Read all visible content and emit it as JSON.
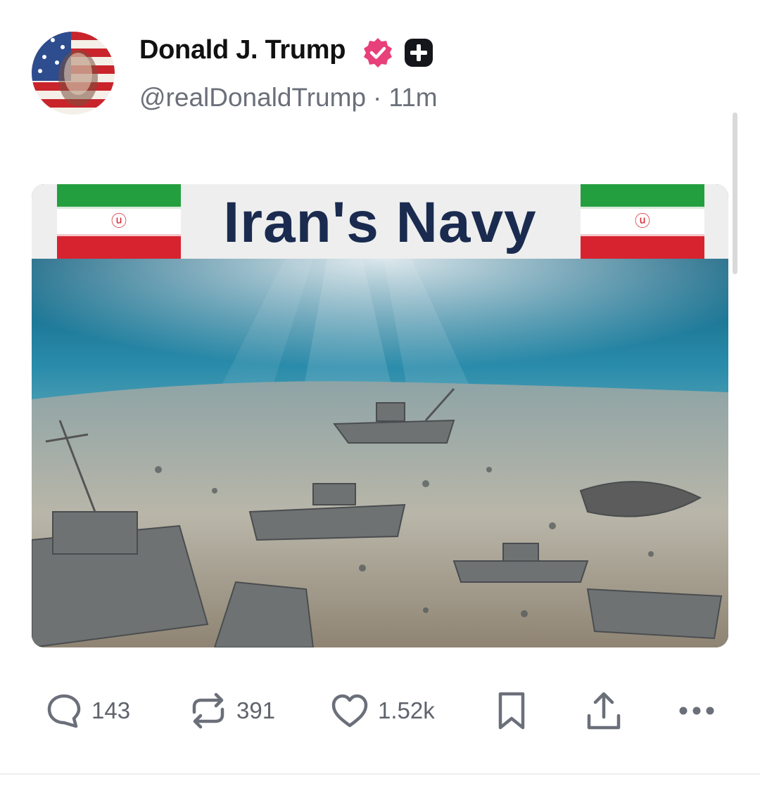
{
  "author": {
    "name": "Donald J. Trump",
    "handle": "@realDonaldTrump",
    "separator": "·",
    "time": "11m",
    "verified_color": "#e8407a"
  },
  "post": {
    "image_title": "Iran's Navy",
    "image_alt_icons": [
      "iran-flag-icon",
      "iran-flag-icon"
    ]
  },
  "actions": {
    "replies": "143",
    "reposts": "391",
    "likes": "1.52k",
    "icons": [
      "reply-icon",
      "repost-icon",
      "heart-icon",
      "bookmark-icon",
      "share-icon",
      "more-icon"
    ]
  },
  "colors": {
    "text_primary": "#111111",
    "text_secondary": "#6b6f7a",
    "action_gray": "#5f636d",
    "banner_title": "#1a2b4f"
  }
}
